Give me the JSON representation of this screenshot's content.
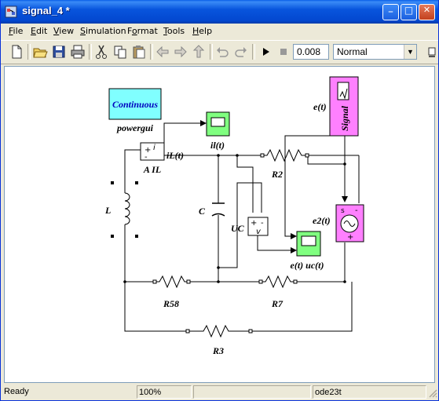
{
  "window": {
    "title": "signal_4 *",
    "controls": {
      "minimize": "_",
      "maximize": "□",
      "close": "✕"
    }
  },
  "menu": {
    "file": {
      "u": "F",
      "rest": "ile"
    },
    "edit": {
      "u": "E",
      "rest": "dit"
    },
    "view": {
      "u": "V",
      "rest": "iew"
    },
    "simulation": {
      "u": "S",
      "rest": "imulation"
    },
    "format": {
      "pre": "F",
      "u": "o",
      "rest": "rmat"
    },
    "tools": {
      "u": "T",
      "rest": "ools"
    },
    "help": {
      "u": "H",
      "rest": "elp"
    }
  },
  "toolbar": {
    "stop_time": "0.008",
    "sim_mode": "Normal",
    "icons": [
      "new-icon",
      "open-icon",
      "save-icon",
      "print-icon",
      "cut-icon",
      "copy-icon",
      "paste-icon",
      "back-icon",
      "forward-icon",
      "up-icon",
      "undo-icon",
      "redo-icon",
      "play-icon",
      "stop-icon"
    ]
  },
  "diagram": {
    "blocks": {
      "powergui": {
        "text": "Continuous",
        "label": "powergui"
      },
      "ammeter": {
        "label": "A IL",
        "plus": "+",
        "minus": "-",
        "i": "i",
        "out": "iL(t)"
      },
      "scope_il": {
        "label": "il(t)"
      },
      "inductor": {
        "label": "L"
      },
      "capacitor": {
        "label": "C"
      },
      "voltmeter": {
        "label": "UC",
        "plus": "+",
        "minus": "-",
        "v": "v"
      },
      "scope_e_uc": {
        "label": "e(t) uc(t)"
      },
      "signal": {
        "text": "Signal",
        "label": "e(t)"
      },
      "source": {
        "label": "e2(t)",
        "s": "s",
        "plus": "+",
        "minus": "-"
      },
      "r2": {
        "label": "R2"
      },
      "r58": {
        "label": "R58"
      },
      "r7": {
        "label": "R7"
      },
      "r3": {
        "label": "R3"
      }
    },
    "colors": {
      "powergui": "#80ffff",
      "scope": "#80ff80",
      "signal": "#ff80ff",
      "source": "#ff80ff"
    }
  },
  "status": {
    "state": "Ready",
    "zoom": "100%",
    "solver": "ode23t"
  }
}
